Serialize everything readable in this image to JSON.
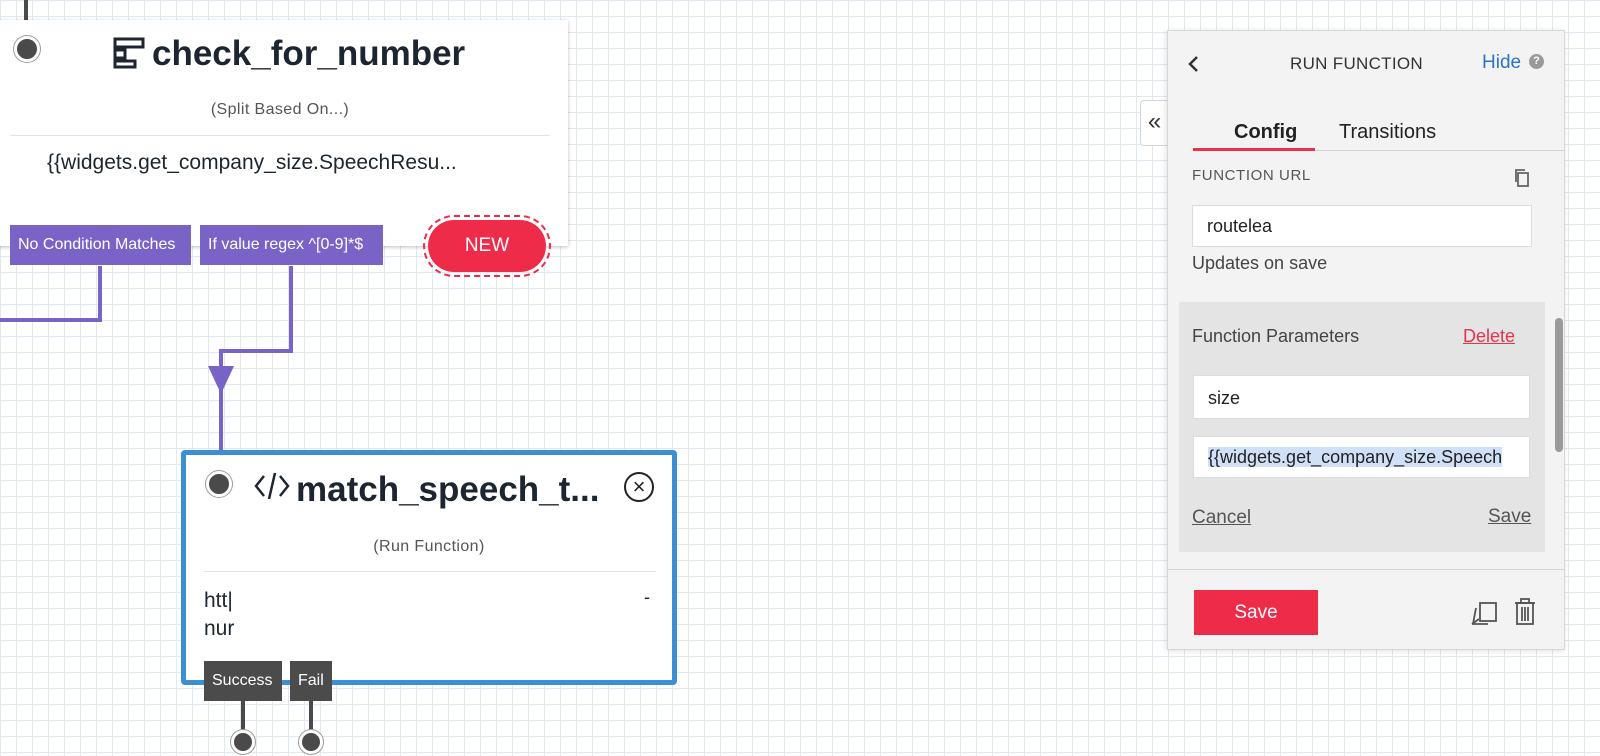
{
  "split_widget": {
    "title": "check_for_number",
    "subtitle": "(Split Based On...)",
    "value": "{{widgets.get_company_size.SpeechResu...",
    "transitions": [
      {
        "label": "No Condition Matches"
      },
      {
        "label": "If value regex ^[0-9]*$"
      }
    ],
    "new_label": "NEW"
  },
  "run_widget": {
    "title": "match_speech_t...",
    "subtitle": "(Run Function)",
    "body_line1": "htt|",
    "body_line2": "nur",
    "body_right": "-",
    "transitions": [
      {
        "label": "Success"
      },
      {
        "label": "Fail"
      }
    ]
  },
  "panel": {
    "header_title": "RUN FUNCTION",
    "hide_label": "Hide",
    "help_icon_text": "?",
    "tabs": [
      {
        "label": "Config",
        "active": true
      },
      {
        "label": "Transitions",
        "active": false
      }
    ],
    "function_url": {
      "label": "FUNCTION URL",
      "value": "routelea",
      "hint": "Updates on save"
    },
    "function_parameters": {
      "title": "Function Parameters",
      "delete_label": "Delete",
      "key_value": "size",
      "value_value": "{{widgets.get_company_size.Speech",
      "cancel_label": "Cancel",
      "save_label": "Save"
    },
    "save_button": "Save"
  },
  "colors": {
    "accent_red": "#ee2b49",
    "selection_blue": "#3d8fd4",
    "transition_purple": "#7a63c7",
    "link_blue": "#2b74c9"
  },
  "icons": [
    "split-icon",
    "function-icon",
    "close-circle-icon",
    "back-chevron-icon",
    "help-icon",
    "copy-icon",
    "duplicate-icon",
    "trash-icon",
    "collapse-panel-icon"
  ]
}
